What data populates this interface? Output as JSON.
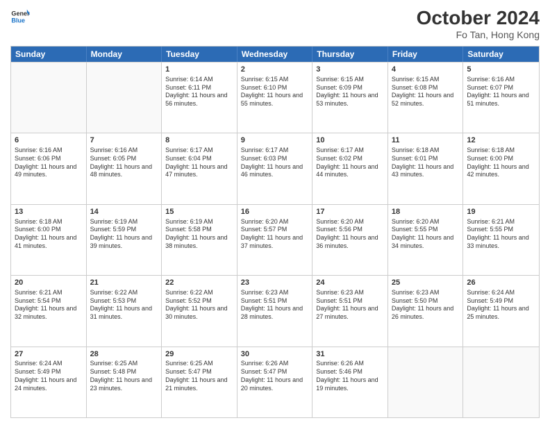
{
  "header": {
    "logo_line1": "General",
    "logo_line2": "Blue",
    "month": "October 2024",
    "location": "Fo Tan, Hong Kong"
  },
  "weekdays": [
    "Sunday",
    "Monday",
    "Tuesday",
    "Wednesday",
    "Thursday",
    "Friday",
    "Saturday"
  ],
  "weeks": [
    [
      {
        "day": "",
        "empty": true
      },
      {
        "day": "",
        "empty": true
      },
      {
        "day": "1",
        "sunrise": "6:14 AM",
        "sunset": "6:11 PM",
        "daylight": "11 hours and 56 minutes."
      },
      {
        "day": "2",
        "sunrise": "6:15 AM",
        "sunset": "6:10 PM",
        "daylight": "11 hours and 55 minutes."
      },
      {
        "day": "3",
        "sunrise": "6:15 AM",
        "sunset": "6:09 PM",
        "daylight": "11 hours and 53 minutes."
      },
      {
        "day": "4",
        "sunrise": "6:15 AM",
        "sunset": "6:08 PM",
        "daylight": "11 hours and 52 minutes."
      },
      {
        "day": "5",
        "sunrise": "6:16 AM",
        "sunset": "6:07 PM",
        "daylight": "11 hours and 51 minutes."
      }
    ],
    [
      {
        "day": "6",
        "sunrise": "6:16 AM",
        "sunset": "6:06 PM",
        "daylight": "11 hours and 49 minutes."
      },
      {
        "day": "7",
        "sunrise": "6:16 AM",
        "sunset": "6:05 PM",
        "daylight": "11 hours and 48 minutes."
      },
      {
        "day": "8",
        "sunrise": "6:17 AM",
        "sunset": "6:04 PM",
        "daylight": "11 hours and 47 minutes."
      },
      {
        "day": "9",
        "sunrise": "6:17 AM",
        "sunset": "6:03 PM",
        "daylight": "11 hours and 46 minutes."
      },
      {
        "day": "10",
        "sunrise": "6:17 AM",
        "sunset": "6:02 PM",
        "daylight": "11 hours and 44 minutes."
      },
      {
        "day": "11",
        "sunrise": "6:18 AM",
        "sunset": "6:01 PM",
        "daylight": "11 hours and 43 minutes."
      },
      {
        "day": "12",
        "sunrise": "6:18 AM",
        "sunset": "6:00 PM",
        "daylight": "11 hours and 42 minutes."
      }
    ],
    [
      {
        "day": "13",
        "sunrise": "6:18 AM",
        "sunset": "6:00 PM",
        "daylight": "11 hours and 41 minutes."
      },
      {
        "day": "14",
        "sunrise": "6:19 AM",
        "sunset": "5:59 PM",
        "daylight": "11 hours and 39 minutes."
      },
      {
        "day": "15",
        "sunrise": "6:19 AM",
        "sunset": "5:58 PM",
        "daylight": "11 hours and 38 minutes."
      },
      {
        "day": "16",
        "sunrise": "6:20 AM",
        "sunset": "5:57 PM",
        "daylight": "11 hours and 37 minutes."
      },
      {
        "day": "17",
        "sunrise": "6:20 AM",
        "sunset": "5:56 PM",
        "daylight": "11 hours and 36 minutes."
      },
      {
        "day": "18",
        "sunrise": "6:20 AM",
        "sunset": "5:55 PM",
        "daylight": "11 hours and 34 minutes."
      },
      {
        "day": "19",
        "sunrise": "6:21 AM",
        "sunset": "5:55 PM",
        "daylight": "11 hours and 33 minutes."
      }
    ],
    [
      {
        "day": "20",
        "sunrise": "6:21 AM",
        "sunset": "5:54 PM",
        "daylight": "11 hours and 32 minutes."
      },
      {
        "day": "21",
        "sunrise": "6:22 AM",
        "sunset": "5:53 PM",
        "daylight": "11 hours and 31 minutes."
      },
      {
        "day": "22",
        "sunrise": "6:22 AM",
        "sunset": "5:52 PM",
        "daylight": "11 hours and 30 minutes."
      },
      {
        "day": "23",
        "sunrise": "6:23 AM",
        "sunset": "5:51 PM",
        "daylight": "11 hours and 28 minutes."
      },
      {
        "day": "24",
        "sunrise": "6:23 AM",
        "sunset": "5:51 PM",
        "daylight": "11 hours and 27 minutes."
      },
      {
        "day": "25",
        "sunrise": "6:23 AM",
        "sunset": "5:50 PM",
        "daylight": "11 hours and 26 minutes."
      },
      {
        "day": "26",
        "sunrise": "6:24 AM",
        "sunset": "5:49 PM",
        "daylight": "11 hours and 25 minutes."
      }
    ],
    [
      {
        "day": "27",
        "sunrise": "6:24 AM",
        "sunset": "5:49 PM",
        "daylight": "11 hours and 24 minutes."
      },
      {
        "day": "28",
        "sunrise": "6:25 AM",
        "sunset": "5:48 PM",
        "daylight": "11 hours and 23 minutes."
      },
      {
        "day": "29",
        "sunrise": "6:25 AM",
        "sunset": "5:47 PM",
        "daylight": "11 hours and 21 minutes."
      },
      {
        "day": "30",
        "sunrise": "6:26 AM",
        "sunset": "5:47 PM",
        "daylight": "11 hours and 20 minutes."
      },
      {
        "day": "31",
        "sunrise": "6:26 AM",
        "sunset": "5:46 PM",
        "daylight": "11 hours and 19 minutes."
      },
      {
        "day": "",
        "empty": true
      },
      {
        "day": "",
        "empty": true
      }
    ]
  ]
}
